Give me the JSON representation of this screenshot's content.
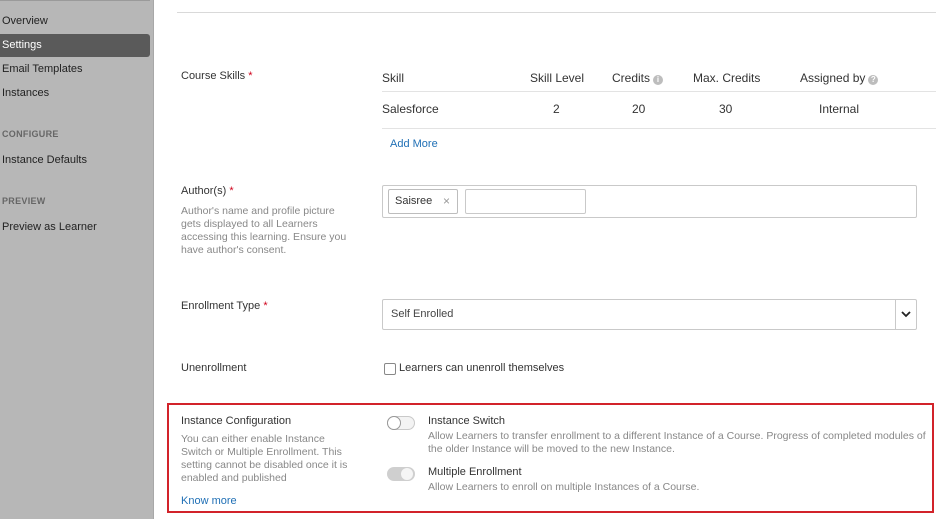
{
  "sidebar": {
    "items": [
      "Overview",
      "Settings",
      "Email Templates",
      "Instances"
    ],
    "configure_header": "CONFIGURE",
    "configure_items": [
      "Instance Defaults"
    ],
    "preview_header": "PREVIEW",
    "preview_items": [
      "Preview as Learner"
    ]
  },
  "skills": {
    "label": "Course Skills",
    "required": "*",
    "headers": {
      "skill": "Skill",
      "skill_level": "Skill Level",
      "credits": "Credits",
      "max_credits": "Max. Credits",
      "assigned_by": "Assigned by"
    },
    "rows": [
      {
        "skill": "Salesforce",
        "skill_level": "2",
        "credits": "20",
        "max_credits": "30",
        "assigned_by": "Internal"
      }
    ],
    "add_more": "Add More",
    "info_glyph": "i",
    "help_glyph": "?"
  },
  "authors": {
    "label": "Author(s)",
    "required": "*",
    "help": "Author's name and profile picture gets displayed to all Learners accessing this learning. Ensure you have author's consent.",
    "chips": [
      "Saisree"
    ],
    "remove_glyph": "×",
    "input_value": ""
  },
  "enrollment": {
    "label": "Enrollment Type",
    "required": "*",
    "selected": "Self Enrolled"
  },
  "unenrollment": {
    "label": "Unenrollment",
    "checkbox_label": "Learners can unenroll themselves",
    "checked": false
  },
  "instance_config": {
    "label": "Instance Configuration",
    "help": "You can either enable Instance Switch or Multiple Enrollment. This setting cannot be disabled once it is enabled and published",
    "know_more": "Know more",
    "switch": {
      "title": "Instance Switch",
      "desc": "Allow Learners to transfer enrollment to a different Instance of a Course. Progress of completed modules of the older Instance will be moved to the new Instance.",
      "on": false
    },
    "multiple": {
      "title": "Multiple Enrollment",
      "desc": "Allow Learners to enroll on multiple Instances of a Course.",
      "on": true,
      "disabled": true
    }
  },
  "colors": {
    "sidebar_bg": "#b7b7b7",
    "sidebar_active": "#5a5a5a",
    "link": "#1f6fb5",
    "required": "#d0021b",
    "highlight": "#d2232a"
  }
}
